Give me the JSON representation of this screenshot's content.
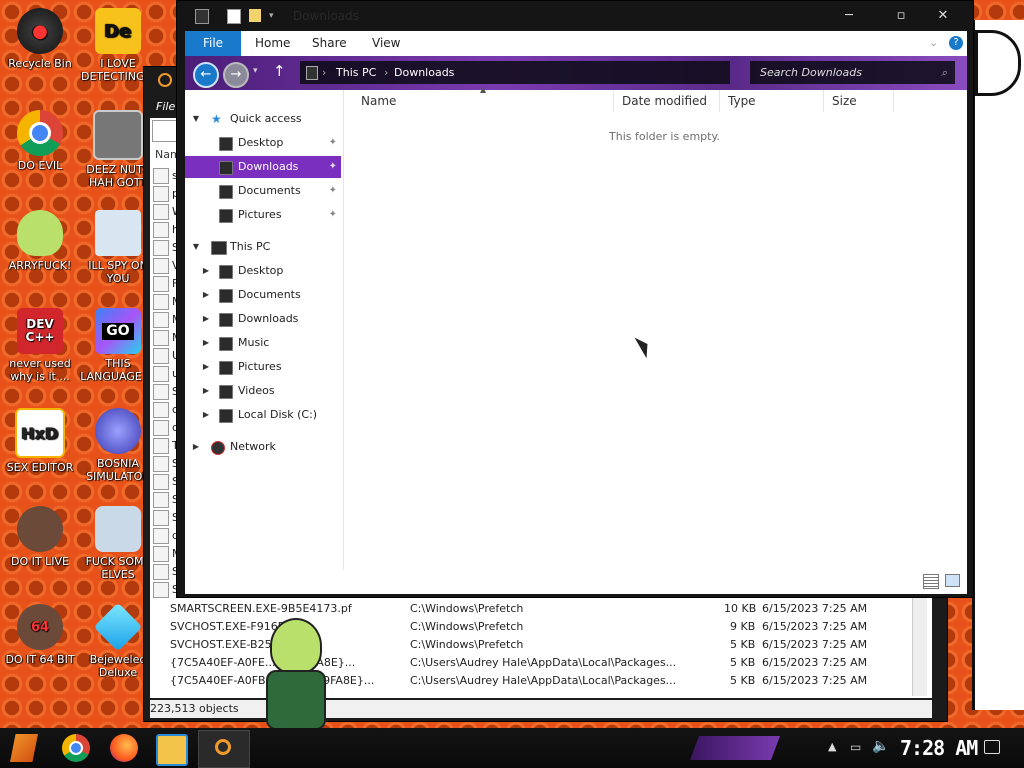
{
  "desktop_icons": [
    {
      "label": "Recycle Bin",
      "icon": "recycle-bin-icon"
    },
    {
      "label": "I LOVE DETECTING...",
      "icon": "de-icon"
    },
    {
      "label": "DO EVIL",
      "icon": "chrome-icon"
    },
    {
      "label": "DEEZ NUTS HAH GOTT",
      "icon": "windows-stack-icon"
    },
    {
      "label": "ARRYFUCK!",
      "icon": "peridot-icon"
    },
    {
      "label": "ILL SPY ON YOU",
      "icon": "spy-icon"
    },
    {
      "label": "never used why is it ...",
      "icon": "dev-cpp-icon"
    },
    {
      "label": "THIS LANGUAGE ...",
      "icon": "goland-icon"
    },
    {
      "label": "SEX EDITOR",
      "icon": "hxd-icon"
    },
    {
      "label": "BOSNIA SIMULATOR",
      "icon": "mine-icon"
    },
    {
      "label": "DO IT LIVE",
      "icon": "portrait-icon"
    },
    {
      "label": "FUCK SOME ELVES",
      "icon": "santa-icon"
    },
    {
      "label": "DO IT 64 BIT",
      "icon": "portrait-64-icon"
    },
    {
      "label": "Bejeweled Deluxe",
      "icon": "gem-icon"
    }
  ],
  "dev_icon_text": [
    "DEV",
    "C++"
  ],
  "go_icon_text": "GO",
  "hxd_icon_text": "HxD",
  "de_icon_text": "De",
  "portrait_64_text": "64",
  "back_window": {
    "title_fragment": "File",
    "col_fragment": "Nam",
    "left_letters": [
      "s",
      "p",
      "W",
      "h",
      "S",
      "V",
      "F",
      "M",
      "M",
      "M",
      "U",
      "u",
      "S",
      "c",
      "c",
      "T",
      "S",
      "S",
      "S",
      "S",
      "d",
      "M",
      "S",
      "S"
    ],
    "rows": [
      {
        "name": "SMARTSCREEN.EXE-9B5E4173.pf",
        "path": "C:\\Windows\\Prefetch",
        "size": "10 KB",
        "date": "6/15/2023 7:25 AM"
      },
      {
        "name": "SVCHOST.EXE-F916FE...",
        "path": "C:\\Windows\\Prefetch",
        "size": "9 KB",
        "date": "6/15/2023 7:25 AM"
      },
      {
        "name": "SVCHOST.EXE-B25...",
        "path": "C:\\Windows\\Prefetch",
        "size": "5 KB",
        "date": "6/15/2023 7:25 AM"
      },
      {
        "name": "{7C5A40EF-A0FE...2E0B9FA8E}...",
        "path": "C:\\Users\\Audrey Hale\\AppData\\Local\\Packages...",
        "size": "5 KB",
        "date": "6/15/2023 7:25 AM"
      },
      {
        "name": "{7C5A40EF-A0FB-4B...2E0B9FA8E}...",
        "path": "C:\\Users\\Audrey Hale\\AppData\\Local\\Packages...",
        "size": "5 KB",
        "date": "6/15/2023 7:25 AM"
      }
    ],
    "status": "223,513 objects"
  },
  "window": {
    "title": "Downloads",
    "ribbon_tabs": [
      "File",
      "Home",
      "Share",
      "View"
    ],
    "breadcrumb": [
      "This PC",
      "Downloads"
    ],
    "search_placeholder": "Search Downloads",
    "columns": [
      "Name",
      "Date modified",
      "Type",
      "Size"
    ],
    "empty_message": "This folder is empty."
  },
  "nav": {
    "quick_access": "Quick access",
    "quick_items": [
      "Desktop",
      "Downloads",
      "Documents",
      "Pictures"
    ],
    "this_pc": "This PC",
    "pc_items": [
      "Desktop",
      "Documents",
      "Downloads",
      "Music",
      "Pictures",
      "Videos",
      "Local Disk (C:)"
    ],
    "network": "Network"
  },
  "taskbar": {
    "clock": "7:28 AM"
  },
  "colors": {
    "accent": "#7b2fbf",
    "file_tab": "#1979ca",
    "desktop": "#e6521a"
  }
}
